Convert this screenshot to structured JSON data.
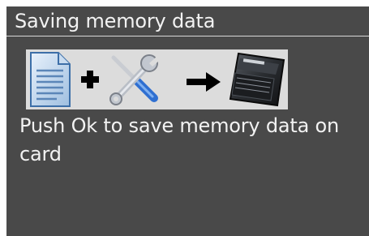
{
  "title": "Saving memory data",
  "banner": {
    "icons": [
      "document-icon",
      "plus-icon",
      "tools-icon",
      "arrow-right-icon",
      "memory-card-icon"
    ]
  },
  "message": "Push Ok to save memory data on card",
  "colors": {
    "screen_background": "#494949",
    "text": "#f2f2f2",
    "banner_background": "#dcdcdc"
  }
}
